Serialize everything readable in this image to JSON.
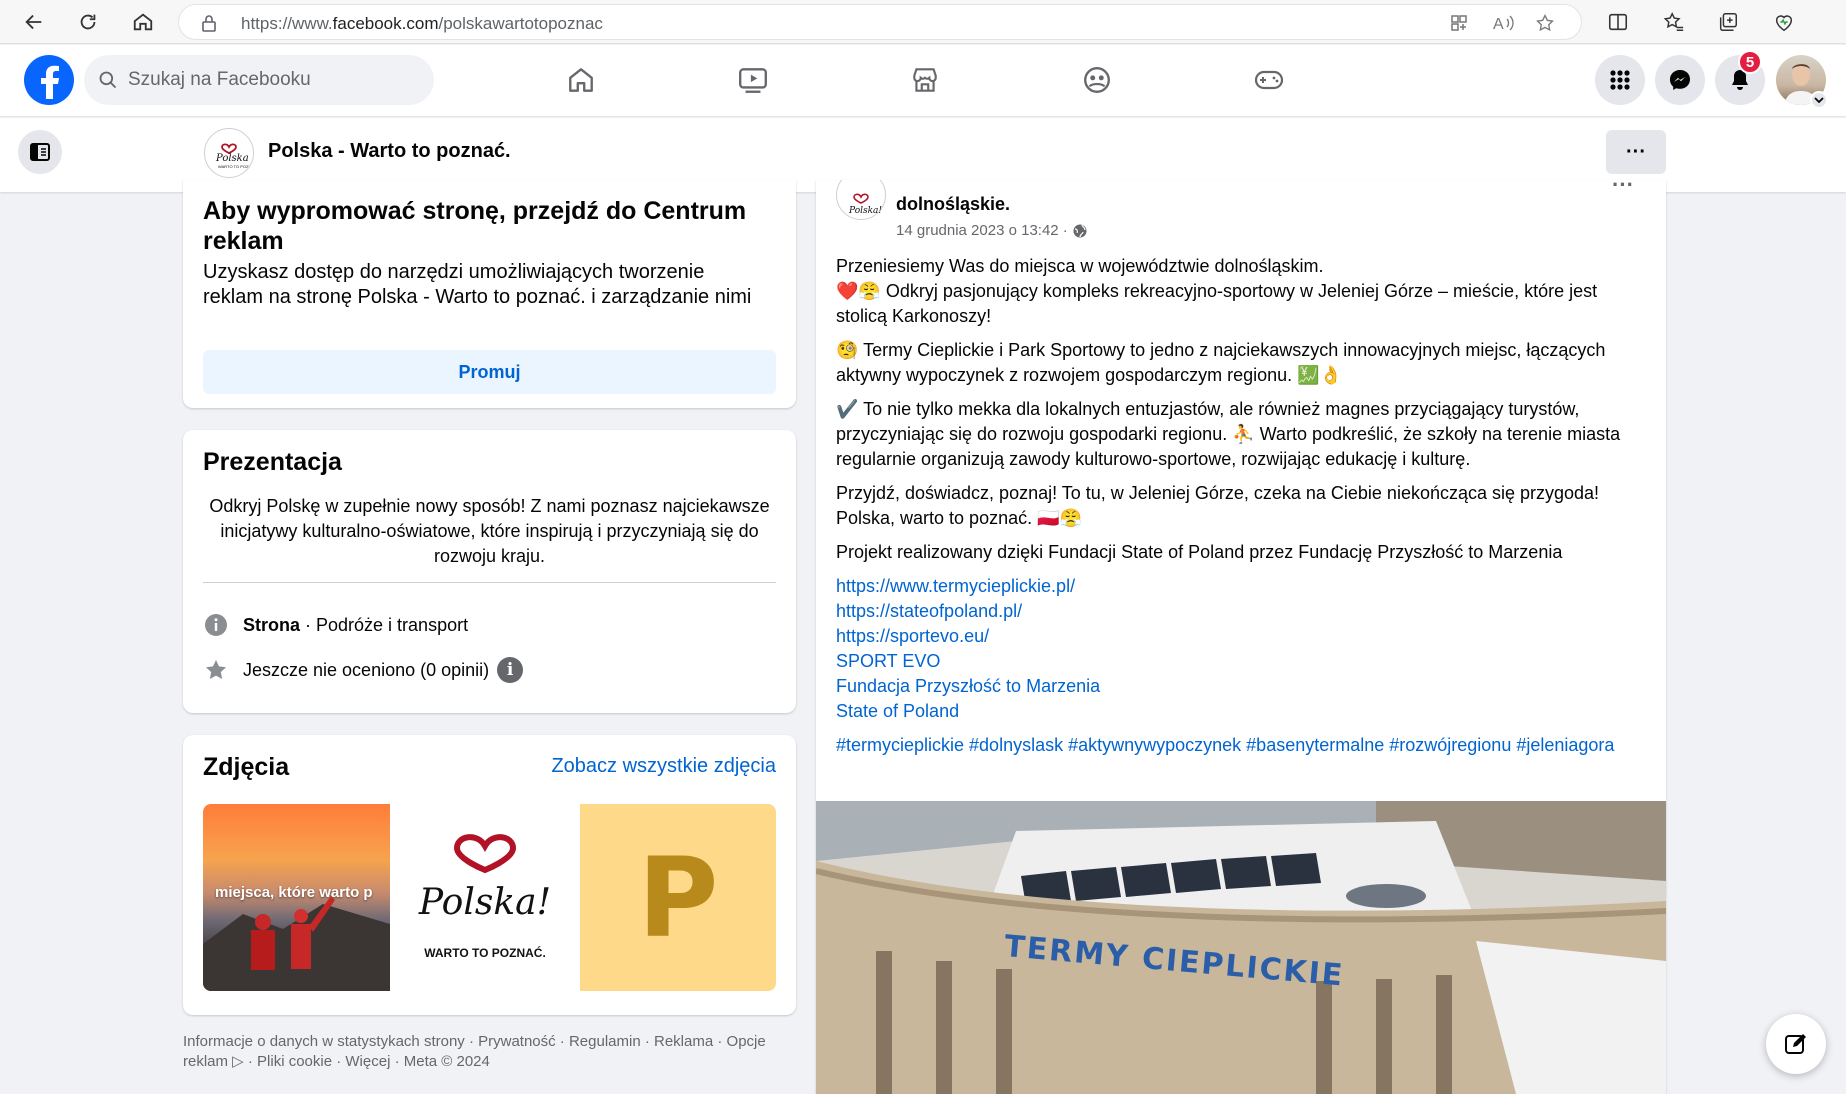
{
  "browser": {
    "url_prefix": "https://www.",
    "url_host": "facebook.com",
    "url_path": "/polskawartotopoznac"
  },
  "topbar": {
    "search_placeholder": "Szukaj na Facebooku",
    "notification_count": "5"
  },
  "page": {
    "name": "Polska - Warto to poznać.",
    "more_label": "···"
  },
  "promo": {
    "title": "Aby wypromować stronę, przejdź do Centrum reklam",
    "text": "Uzyskasz dostęp do narzędzi umożliwiających tworzenie reklam na stronę Polska - Warto to poznać. i zarządzanie nimi",
    "button": "Promuj"
  },
  "about": {
    "title": "Prezentacja",
    "intro": "Odkryj Polskę w zupełnie nowy sposób! Z nami poznasz najciekawsze inicjatywy kulturalno-oświatowe, które inspirują i przyczyniają się do rozwoju kraju.",
    "category_bold": "Strona",
    "category_rest": " · Podróże i transport",
    "rating": "Jeszcze nie oceniono (0 opinii)"
  },
  "photos": {
    "title": "Zdjęcia",
    "see_all": "Zobacz wszystkie zdjęcia",
    "thumb1_caption": "miejsca, które warto p",
    "logo_word": "Polska!",
    "logo_tagline": "WARTO TO POZNAĆ.",
    "thumb3_letter": "P"
  },
  "footer": {
    "text": "Informacje o danych w statystykach strony · Prywatność · Regulamin · Reklama · Opcje reklam ▷ · Pliki cookie · Więcej · Meta © 2024"
  },
  "post": {
    "author_line": "dolnośląskie.",
    "time": "14 grudnia 2023 o 13:42 ·",
    "p1": "Przeniesiemy Was do miejsca w województwie dolnośląskim.",
    "p1b": "❤️😤 Odkryj pasjonujący kompleks rekreacyjno-sportowy w Jeleniej Górze – mieście, które jest stolicą Karkonoszy!",
    "p2": "🧐 Termy Cieplickie i Park Sportowy to jedno z najciekawszych innowacyjnych miejsc, łączących aktywny wypoczynek z rozwojem gospodarczym regionu. 💹👌",
    "p3": "✔️ To nie tylko mekka dla lokalnych entuzjastów, ale również magnes przyciągający turystów, przyczyniając się do rozwoju gospodarki regionu. ⛹️ Warto podkreślić, że szkoły na terenie miasta regularnie organizują zawody kulturowo-sportowe, rozwijając edukację i kulturę.",
    "p4": "Przyjdź, doświadcz, poznaj! To tu, w Jeleniej Górze, czeka na Ciebie niekończąca się przygoda! Polska, warto to poznać. 🇵🇱😤",
    "p5": "Projekt realizowany dzięki Fundacji State of Poland przez Fundację Przyszłość to Marzenia",
    "links": [
      "https://www.termycieplickie.pl/",
      "https://stateofpoland.pl/",
      "https://sportevo.eu/",
      "SPORT EVO",
      "Fundacja Przyszłość to Marzenia",
      "State of Poland"
    ],
    "hashtags": "#termycieplickie #dolnyslask #aktywnywypoczynek #basenytermalne #rozwójregionu #jeleniagora",
    "image_sign": "TERMY CIEPLICKIE"
  },
  "colors": {
    "facebook_blue": "#0866ff",
    "link_blue": "#0064d1",
    "badge_red": "#e41e3f",
    "page_bg": "#f0f2f5"
  }
}
